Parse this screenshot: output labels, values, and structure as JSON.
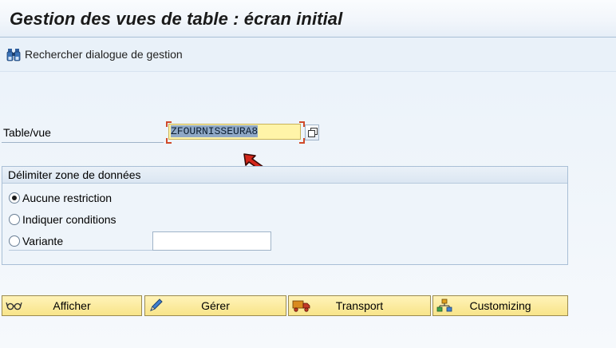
{
  "header": {
    "title": "Gestion des vues de table : écran initial"
  },
  "toolbar": {
    "find_dialog_label": "Rechercher dialogue de gestion",
    "find_dialog_icon": "binoculars-icon"
  },
  "table_view": {
    "label": "Table/vue",
    "value": "ZFOURNISSEURA8",
    "help_icon": "value-help-icon"
  },
  "restriction_group": {
    "title": "Délimiter zone de données",
    "options": [
      {
        "label": "Aucune restriction",
        "checked": true
      },
      {
        "label": "Indiquer conditions",
        "checked": false
      },
      {
        "label": "Variante",
        "checked": false
      }
    ],
    "variant_value": ""
  },
  "actions": {
    "display_label": "Afficher",
    "maintain_label": "Gérer",
    "transport_label": "Transport",
    "customizing_label": "Customizing"
  },
  "colors": {
    "button_fill": "#f8e48a",
    "input_highlight": "#fff4a8",
    "focus_marker": "#d04a2a",
    "selection": "#8fa8c6"
  }
}
